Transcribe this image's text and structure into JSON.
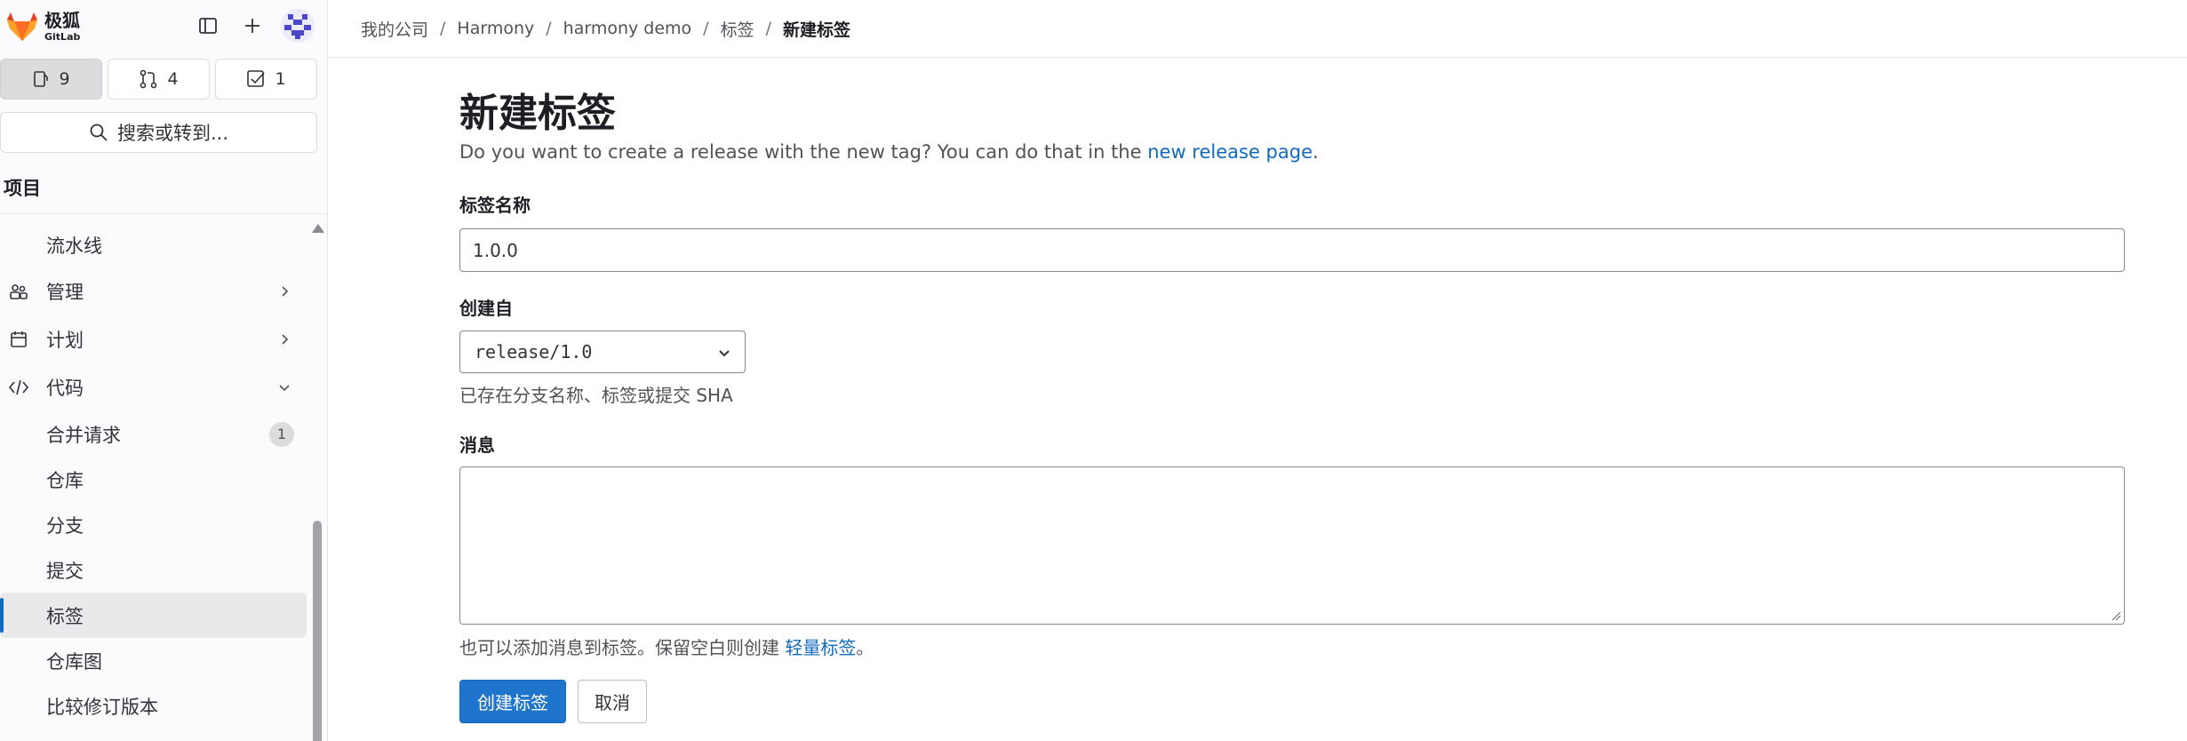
{
  "brand": {
    "name": "极狐",
    "sub": "GitLab"
  },
  "counters": [
    {
      "icon": "issues-icon",
      "value": "9"
    },
    {
      "icon": "merge-request-icon",
      "value": "4"
    },
    {
      "icon": "todo-icon",
      "value": "1"
    }
  ],
  "search": {
    "label": "搜索或转到..."
  },
  "sidebar": {
    "section": "项目",
    "items": [
      {
        "label": "流水线",
        "sub": true
      },
      {
        "label": "管理",
        "icon": "users-icon",
        "chevron": "right"
      },
      {
        "label": "计划",
        "icon": "calendar-icon",
        "chevron": "right"
      },
      {
        "label": "代码",
        "icon": "code-icon",
        "chevron": "down"
      },
      {
        "label": "合并请求",
        "sub": true,
        "badge": "1"
      },
      {
        "label": "仓库",
        "sub": true
      },
      {
        "label": "分支",
        "sub": true
      },
      {
        "label": "提交",
        "sub": true
      },
      {
        "label": "标签",
        "sub": true,
        "active": true
      },
      {
        "label": "仓库图",
        "sub": true
      },
      {
        "label": "比较修订版本",
        "sub": true
      }
    ]
  },
  "breadcrumb": [
    "我的公司",
    "Harmony",
    "harmony demo",
    "标签",
    "新建标签"
  ],
  "form": {
    "title": "新建标签",
    "description_prefix": "Do you want to create a release with the new tag? You can do that in the ",
    "description_link": "new release page",
    "description_suffix": ".",
    "tag_name_label": "标签名称",
    "tag_name_value": "1.0.0",
    "create_from_label": "创建自",
    "create_from_value": "release/1.0",
    "create_from_help": "已存在分支名称、标签或提交 SHA",
    "message_label": "消息",
    "message_value": "",
    "message_help_prefix": "也可以添加消息到标签。保留空白则创建 ",
    "message_help_link": "轻量标签",
    "message_help_suffix": "。",
    "submit_label": "创建标签",
    "cancel_label": "取消"
  },
  "colors": {
    "accent": "#1068bf",
    "primary_button": "#1f75cb",
    "brand_orange": "#e24329"
  }
}
